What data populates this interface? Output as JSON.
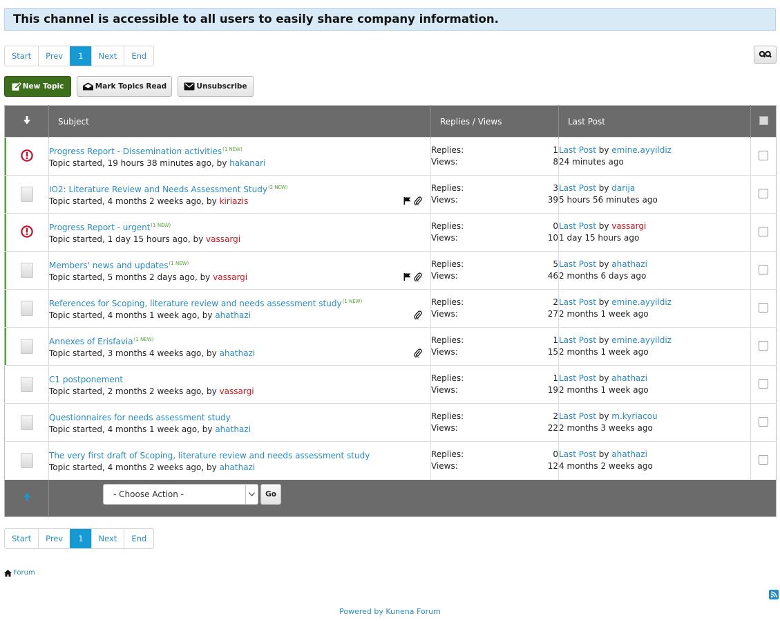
{
  "banner": "This channel is accessible to all users to easily share company information.",
  "pagination": {
    "start": "Start",
    "prev": "Prev",
    "current": "1",
    "next": "Next",
    "end": "End"
  },
  "buttons": {
    "new_topic": "New Topic",
    "mark_read": "Mark Topics Read",
    "unsubscribe": "Unsubscribe",
    "go": "Go"
  },
  "table": {
    "headers": {
      "subject": "Subject",
      "replies_views": "Replies / Views",
      "last_post": "Last Post"
    },
    "labels": {
      "replies": "Replies:",
      "views": "Views:",
      "last_post_link": "Last Post",
      "by": "by"
    },
    "topics": [
      {
        "title": "Progress Report - Dissemination activities",
        "new_tag": "(1 NEW)",
        "started": "Topic started, 19 hours 38 minutes ago, by",
        "author": "hakanari",
        "author_color": "blue",
        "replies": "1",
        "views": "8",
        "last_user": "emine.ayyildiz",
        "last_user_color": "blue",
        "last_time": "24 minutes ago",
        "icon": "alert-icon",
        "is_new": true
      },
      {
        "title": "IO2: Literature Review and Needs Assessment Study",
        "new_tag": "(2 NEW)",
        "started": "Topic started, 4 months 2 weeks ago, by",
        "author": "kiriazis",
        "author_color": "red",
        "replies": "3",
        "views": "39",
        "last_user": "darija",
        "last_user_color": "blue",
        "last_time": "5 hours 56 minutes ago",
        "icon": "document-icon",
        "is_new": true,
        "flag": true,
        "attachment": true
      },
      {
        "title": "Progress Report - urgent",
        "new_tag": "(1 NEW)",
        "started": "Topic started, 1 day 15 hours ago, by",
        "author": "vassargi",
        "author_color": "red",
        "replies": "0",
        "views": "10",
        "last_user": "vassargi",
        "last_user_color": "red",
        "last_time": "1 day 15 hours ago",
        "icon": "alert-icon",
        "is_new": true
      },
      {
        "title": "Members' news and updates",
        "new_tag": "(1 NEW)",
        "started": "Topic started, 5 months 2 days ago, by",
        "author": "vassargi",
        "author_color": "red",
        "replies": "5",
        "views": "46",
        "last_user": "ahathazi",
        "last_user_color": "blue",
        "last_time": "2 months 6 days ago",
        "icon": "document-icon",
        "is_new": true,
        "flag": true,
        "attachment": true
      },
      {
        "title": "References for Scoping, literature review and needs assessment study",
        "new_tag": "(1 NEW)",
        "started": "Topic started, 4 months 1 week ago, by",
        "author": "ahathazi",
        "author_color": "blue",
        "replies": "2",
        "views": "27",
        "last_user": "emine.ayyildiz",
        "last_user_color": "blue",
        "last_time": "2 months 1 week ago",
        "icon": "document-icon",
        "is_new": true,
        "attachment": true
      },
      {
        "title": "Annexes of Erisfavia",
        "new_tag": "(1 NEW)",
        "started": "Topic started, 3 months 4 weeks ago, by",
        "author": "ahathazi",
        "author_color": "blue",
        "replies": "1",
        "views": "15",
        "last_user": "emine.ayyildiz",
        "last_user_color": "blue",
        "last_time": "2 months 1 week ago",
        "icon": "document-icon",
        "is_new": true,
        "attachment": true
      },
      {
        "title": "C1 postponement",
        "new_tag": "",
        "started": "Topic started, 2 months 2 weeks ago, by",
        "author": "vassargi",
        "author_color": "red",
        "replies": "1",
        "views": "19",
        "last_user": "ahathazi",
        "last_user_color": "blue",
        "last_time": "2 months 1 week ago",
        "icon": "document-icon",
        "is_new": false
      },
      {
        "title": "Questionnaires for needs assessment study",
        "new_tag": "",
        "started": "Topic started, 4 months 1 week ago, by",
        "author": "ahathazi",
        "author_color": "blue",
        "replies": "2",
        "views": "22",
        "last_user": "m.kyriacou",
        "last_user_color": "blue",
        "last_time": "2 months 3 weeks ago",
        "icon": "document-icon",
        "is_new": false
      },
      {
        "title": "The very first draft of Scoping, literature review and needs assessment study",
        "new_tag": "",
        "started": "Topic started, 4 months 2 weeks ago, by",
        "author": "ahathazi",
        "author_color": "blue",
        "replies": "0",
        "views": "12",
        "last_user": "ahathazi",
        "last_user_color": "blue",
        "last_time": "4 months 2 weeks ago",
        "icon": "document-icon",
        "is_new": false
      }
    ]
  },
  "bulk_action": {
    "selected": "- Choose Action -"
  },
  "breadcrumb": {
    "label": "Forum"
  },
  "footer": {
    "powered_by": "Powered by Kunena Forum"
  },
  "colors": {
    "link": "#2a8bc9",
    "author_red": "#e0141e",
    "new_green": "#4ea72e",
    "new_topic_btn": "#3d6e1c",
    "active_page": "#169ad3",
    "header_bg": "#6b6b6b"
  }
}
